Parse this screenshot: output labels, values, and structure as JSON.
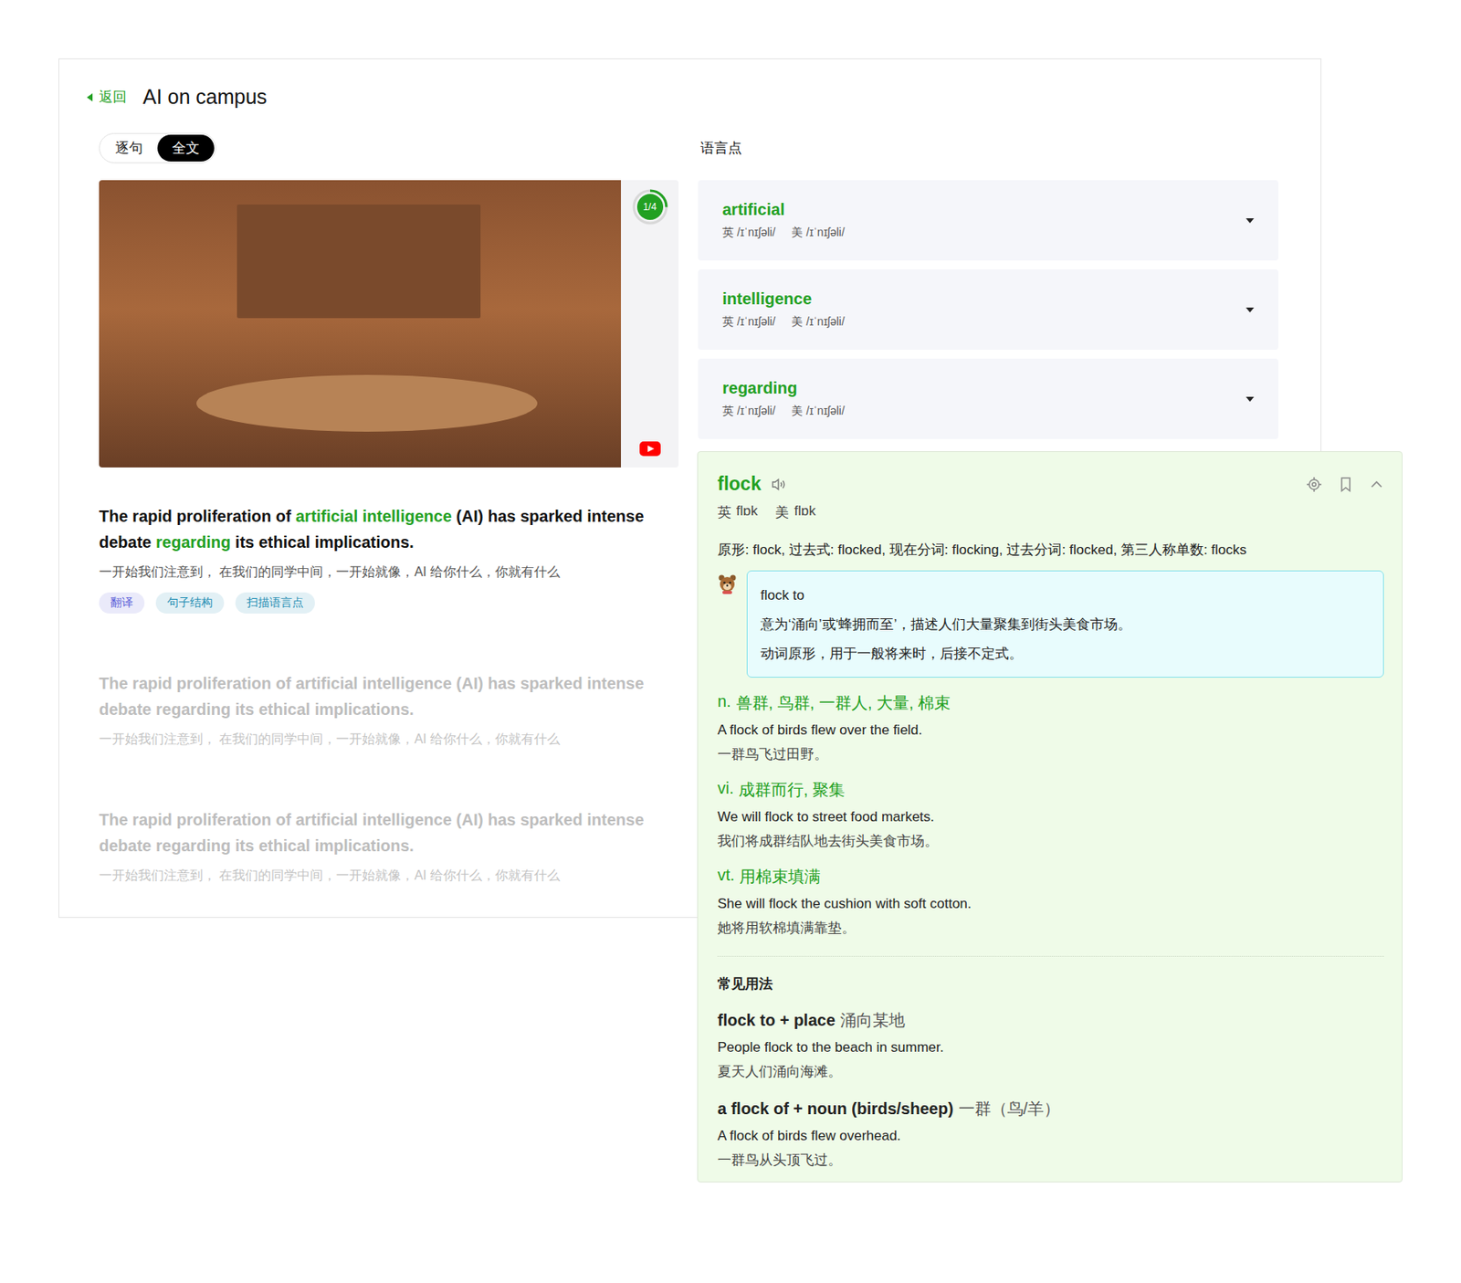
{
  "header": {
    "back": "返回",
    "title": "AI on campus"
  },
  "mode_tabs": [
    {
      "label": "逐句",
      "selected": false
    },
    {
      "label": "全文",
      "selected": true
    }
  ],
  "video": {
    "progress_label": "1/4",
    "level": 0.25
  },
  "sentences": [
    {
      "active": true,
      "segments": [
        {
          "text": "The rapid proliferation of ",
          "highlight": false
        },
        {
          "text": "artificial intelligence",
          "highlight": true
        },
        {
          "text": " (AI) has sparked intense debate ",
          "highlight": false
        },
        {
          "text": "regarding",
          "highlight": true
        },
        {
          "text": " its ethical implications.",
          "highlight": false
        }
      ],
      "translation": "一开始我们注意到， 在我们的同学中间，一开始就像，AI 给你什么，你就有什么",
      "tags": [
        {
          "label": "翻译",
          "color": "#5a5fd8"
        },
        {
          "label": "句子结构",
          "color": "#1d8db3"
        },
        {
          "label": "扫描语言点",
          "color": "#1d8db3"
        }
      ]
    },
    {
      "active": false,
      "segments": [
        {
          "text": "The rapid proliferation of artificial intelligence (AI) has sparked intense debate regarding its ethical implications.",
          "highlight": false
        }
      ],
      "translation": "一开始我们注意到， 在我们的同学中间，一开始就像，AI 给你什么，你就有什么",
      "tags": []
    },
    {
      "active": false,
      "segments": [
        {
          "text": "The rapid proliferation of artificial intelligence (AI) has sparked intense debate regarding its ethical implications.",
          "highlight": false
        }
      ],
      "translation": "一开始我们注意到， 在我们的同学中间，一开始就像，AI 给你什么，你就有什么",
      "tags": []
    }
  ],
  "language_points": {
    "title": "语言点",
    "items": [
      {
        "word": "artificial",
        "uk_label": "英",
        "uk": "/ɪˈnɪʃəli/",
        "us_label": "美",
        "us": "/ɪˈnɪʃəli/",
        "expanded": false
      },
      {
        "word": "intelligence",
        "uk_label": "英",
        "uk": "/ɪˈnɪʃəli/",
        "us_label": "美",
        "us": "/ɪˈnɪʃəli/",
        "expanded": false
      },
      {
        "word": "regarding",
        "uk_label": "英",
        "uk": "/ɪˈnɪʃəli/",
        "us_label": "美",
        "us": "/ɪˈnɪʃəli/",
        "expanded": false
      }
    ]
  },
  "word_card": {
    "word": "flock",
    "uk_label": "英",
    "uk": "flɒk",
    "us_label": "美",
    "us": "flɒk",
    "expanded": true,
    "forms": "原形: flock, 过去式: flocked, 现在分词: flocking, 过去分词: flocked, 第三人称单数: flocks",
    "note": {
      "title": "flock to",
      "lines": [
        "意为‘涌向’或‘蜂拥而至’，描述人们大量聚集到街头美食市场。",
        "动词原形，用于一般将来时，后接不定式。"
      ]
    },
    "senses": [
      {
        "pos": "n.",
        "meaning": "兽群, 鸟群, 一群人, 大量, 棉束",
        "example": "A flock of birds flew over the field.",
        "translation": "一群鸟飞过田野。"
      },
      {
        "pos": "vi.",
        "meaning": "成群而行, 聚集",
        "example": "We will flock to street food markets.",
        "translation": "我们将成群结队地去街头美食市场。"
      },
      {
        "pos": "vt.",
        "meaning": "用棉束填满",
        "example": "She will flock the cushion with soft cotton.",
        "translation": "她将用软棉填满靠垫。"
      }
    ],
    "usage_title": "常见用法",
    "usages": [
      {
        "pattern": "flock to + place",
        "meaning": "涌向某地",
        "example": "People flock to the beach in summer.",
        "translation": "夏天人们涌向海滩。"
      },
      {
        "pattern": "a flock of + noun (birds/sheep)",
        "meaning": "一群（鸟/羊）",
        "example": "A flock of birds flew overhead.",
        "translation": "一群鸟从头顶飞过。"
      }
    ]
  }
}
